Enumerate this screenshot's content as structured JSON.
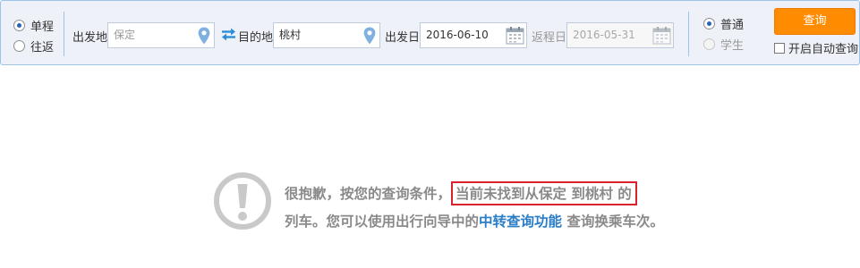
{
  "trip_type": {
    "one_way": "单程",
    "round_trip": "往返",
    "selected": "one_way"
  },
  "from": {
    "label": "出发地",
    "value": "保定",
    "icon": "map-pin-icon"
  },
  "swap_icon": "swap-arrows-icon",
  "to": {
    "label": "目的地",
    "value": "桃村",
    "icon": "map-pin-icon"
  },
  "depart": {
    "label": "出发日",
    "value": "2016-06-10",
    "icon": "calendar-icon"
  },
  "return": {
    "label": "返程日",
    "value": "2016-05-31",
    "icon": "calendar-icon"
  },
  "passenger_type": {
    "normal": "普通",
    "student": "学生",
    "selected": "normal"
  },
  "query_button": "查询",
  "auto_query_label": "开启自动查询",
  "message": {
    "part1": "很抱歉，按您的查询条件，",
    "highlight": "当前未找到从保定 到桃村 的",
    "part2": "列车。您可以使用出行向导中的",
    "link": "中转查询功能",
    "part3": " 查询换乘车次。",
    "icon": "exclamation-circle-icon"
  },
  "colors": {
    "accent_orange": "#ff8b00",
    "link_blue": "#2a7dc6",
    "highlight_red": "#d9232c",
    "bar_background": "#eef1f8"
  }
}
